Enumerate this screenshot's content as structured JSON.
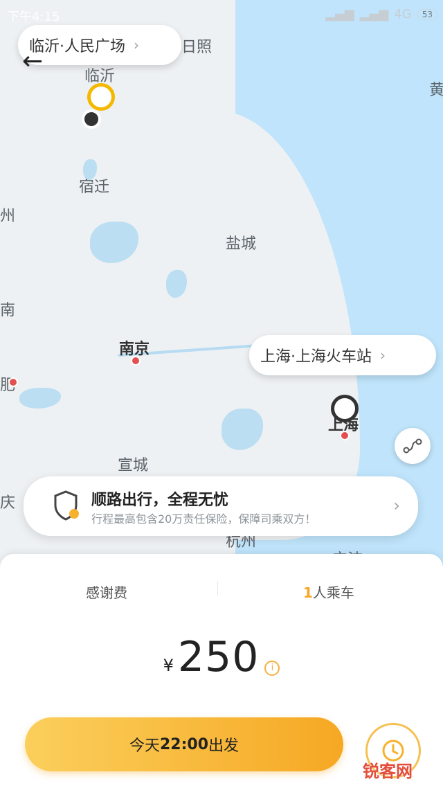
{
  "status_bar": {
    "time": "下午4:15",
    "network": "4G",
    "battery": "53"
  },
  "map": {
    "cities": {
      "rizhao": "日照",
      "linyi": "临沂",
      "suqian": "宿迁",
      "yancheng": "盐城",
      "nanjing": "南京",
      "shanghai": "上海",
      "xuancheng": "宣城",
      "hangzhou": "杭州",
      "huang": "黄",
      "left_1": "州",
      "left_2": "南",
      "left_3": "肥",
      "left_4": "庆",
      "bottom_right": "宁波"
    },
    "origin_label": "临沂·人民广场",
    "destination_label": "上海·上海火车站"
  },
  "insurance": {
    "title": "顺路出行，全程无忧",
    "subtitle": "行程最高包含20万责任保险，保障司乘双方！"
  },
  "sheet": {
    "tab_thanks": "感谢费",
    "passenger_count": "1",
    "passenger_suffix": "人乘车",
    "currency": "¥",
    "price": "250",
    "depart_prefix": "今天",
    "depart_time": "22:00",
    "depart_suffix": "出发"
  },
  "watermark": "锐客网",
  "colors": {
    "accent": "#f6a823",
    "origin_pin": "#f5b800",
    "destination_pin": "#333333"
  }
}
